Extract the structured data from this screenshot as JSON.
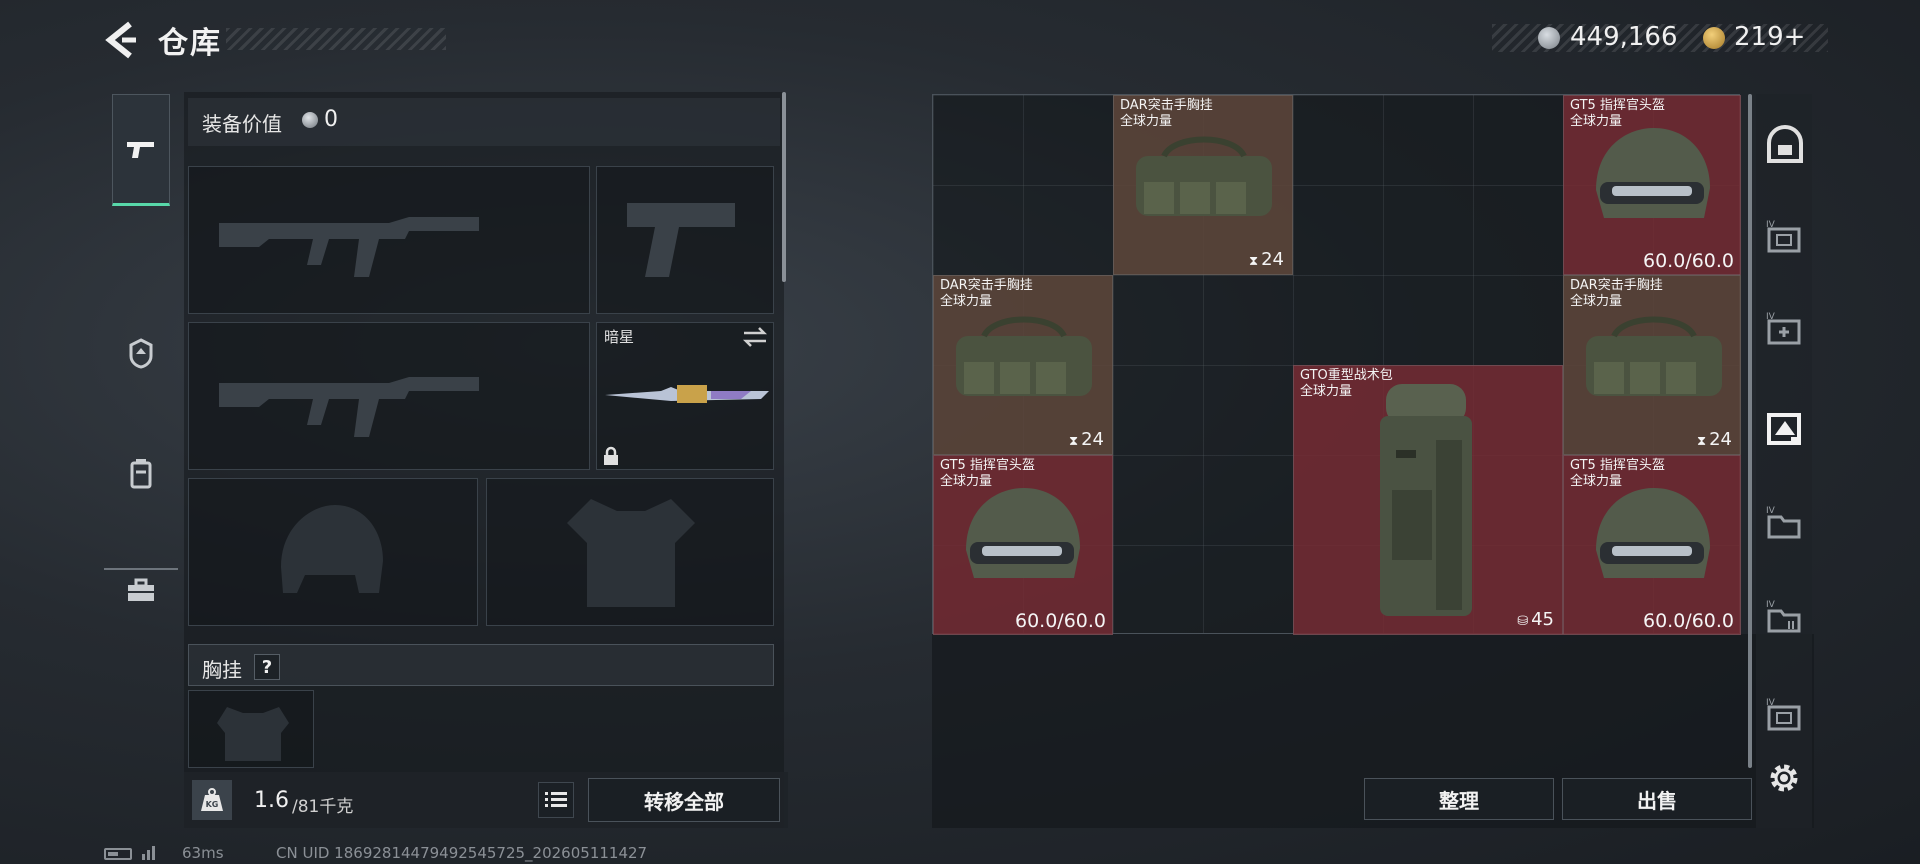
{
  "header": {
    "title": "仓库",
    "coin_amount": "449,166",
    "gold_amount": "219+"
  },
  "left_tabs": [
    {
      "name": "weapons-tab-icon",
      "active": true
    },
    {
      "name": "operator-tab-icon",
      "active": false
    },
    {
      "name": "backpack-tab-icon",
      "active": false
    },
    {
      "name": "toolbox-tab-icon",
      "active": false
    }
  ],
  "loadout": {
    "value_label": "装备价值",
    "value_amount": "0",
    "melee_name": "暗星",
    "rig_label": "胸挂",
    "rig_help": "?"
  },
  "bottom_left": {
    "weight_current": "1.6",
    "weight_max": "/81千克",
    "transfer_all": "转移全部",
    "ping": "63ms",
    "uid": "CN UID 1869281447949254572​5_202605111427"
  },
  "stash_items": [
    {
      "name": "DAR突击手胸挂",
      "sub": "全球力量",
      "count": "24",
      "rarity": "brown"
    },
    {
      "name": "GT5 指挥官头盔",
      "sub": "全球力量",
      "durability": "60.0/60.0",
      "rarity": "red"
    },
    {
      "name": "DAR突击手胸挂",
      "sub": "全球力量",
      "count": "24",
      "rarity": "brown"
    },
    {
      "name": "DAR突击手胸挂",
      "sub": "全球力量",
      "count": "24",
      "rarity": "brown"
    },
    {
      "name": "GTO重型战术包",
      "sub": "全球力量",
      "count": "45",
      "rarity": "red"
    },
    {
      "name": "GT5 指挥官头盔",
      "sub": "全球力量",
      "durability": "60.0/60.0",
      "rarity": "red"
    },
    {
      "name": "GT5 指挥官头盔",
      "sub": "全球力量",
      "durability": "60.0/60.0",
      "rarity": "red"
    }
  ],
  "right_tabs": [
    "safe-tab-icon",
    "case-iv-1-icon",
    "case-iv-add-icon",
    "case-selected-icon",
    "case-iv-2-icon",
    "case-iv-3-icon",
    "case-iv-4-icon"
  ],
  "actions": {
    "sort": "整理",
    "sell": "出售"
  },
  "colors": {
    "accent_green": "#58d8a9",
    "rarity_red": "#762c34",
    "rarity_brown": "#5c463a"
  }
}
